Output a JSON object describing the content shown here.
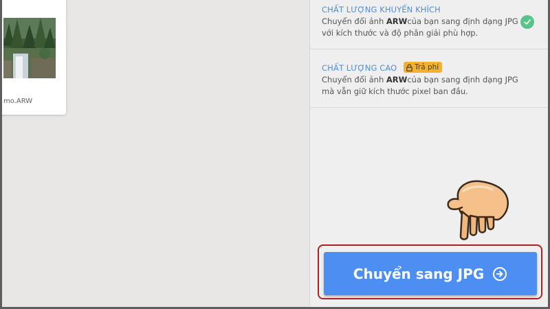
{
  "file": {
    "name": "mo.ARW"
  },
  "options": {
    "recommended": {
      "title": "CHẤT LƯỢNG KHUYẾN KHÍCH",
      "desc_prefix": "Chuyển đổi ảnh ",
      "desc_format": "ARW",
      "desc_line1_rest": "của bạn sang định dạng JPG",
      "desc_line2": "với kích thước và độ phân giải phù hợp.",
      "selected_icon": "check-circle-icon"
    },
    "high": {
      "title": "CHẤT LƯỢNG CAO",
      "badge": "Trả phí",
      "badge_icon": "lock-icon",
      "desc_prefix": "Chuyển đổi ảnh ",
      "desc_format": "ARW",
      "desc_line1_rest": "của bạn sang định dạng JPG",
      "desc_line2": "mà vẫn giữ kích thước pixel ban đầu."
    }
  },
  "convert": {
    "label": "Chuyển sang JPG",
    "icon": "arrow-right-circle-icon"
  },
  "colors": {
    "accent_blue": "#4d8ef2",
    "title_blue": "#4a8ee3",
    "check_green": "#59c48a",
    "badge_yellow": "#f2b230",
    "highlight_red": "#b02020",
    "hand_skin": "#f5c08a"
  }
}
